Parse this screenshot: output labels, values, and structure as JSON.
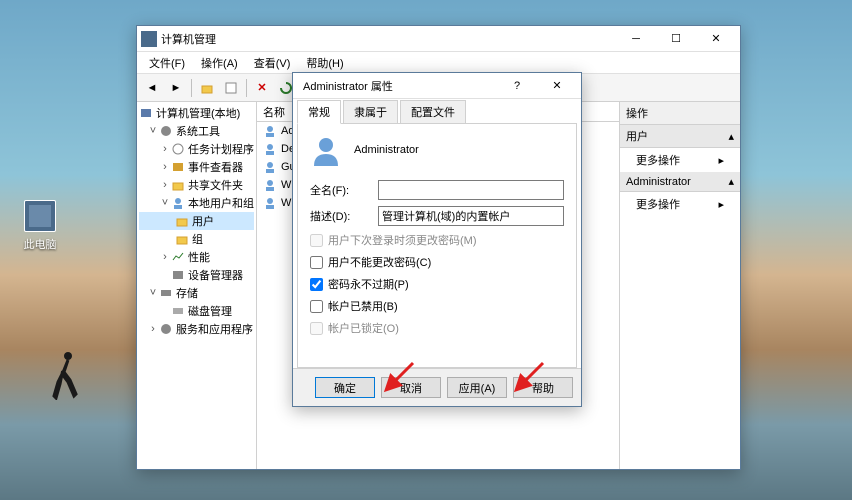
{
  "desktop": {
    "icon_label": "此电脑"
  },
  "mgmt": {
    "title": "计算机管理",
    "menu": [
      "文件(F)",
      "操作(A)",
      "查看(V)",
      "帮助(H)"
    ],
    "tree": {
      "root": "计算机管理(本地)",
      "system_tools": "系统工具",
      "task_scheduler": "任务计划程序",
      "event_viewer": "事件查看器",
      "shared_folders": "共享文件夹",
      "local_users": "本地用户和组",
      "users": "用户",
      "groups": "组",
      "performance": "性能",
      "device_mgr": "设备管理器",
      "storage": "存储",
      "disk_mgmt": "磁盘管理",
      "services_apps": "服务和应用程序"
    },
    "list": {
      "header_name": "名称",
      "rows": [
        "Administrator",
        "DefaultAccount",
        "Guest",
        "WDAGUtilityAccount",
        "Windows"
      ]
    },
    "actions": {
      "pane_title": "操作",
      "section_users": "用户",
      "more_actions": "更多操作",
      "section_admin": "Administrator"
    }
  },
  "dialog": {
    "title": "Administrator 属性",
    "tabs": {
      "general": "常规",
      "member_of": "隶属于",
      "profile": "配置文件"
    },
    "username": "Administrator",
    "full_name_label": "全名(F):",
    "full_name_value": "",
    "description_label": "描述(D):",
    "description_value": "管理计算机(域)的内置帐户",
    "checks": {
      "must_change": "用户下次登录时须更改密码(M)",
      "cannot_change": "用户不能更改密码(C)",
      "never_expires": "密码永不过期(P)",
      "disabled": "帐户已禁用(B)",
      "locked": "帐户已锁定(O)"
    },
    "check_state": {
      "must_change": false,
      "cannot_change": false,
      "never_expires": true,
      "disabled": false,
      "locked": false
    },
    "buttons": {
      "ok": "确定",
      "cancel": "取消",
      "apply": "应用(A)",
      "help": "帮助"
    }
  }
}
